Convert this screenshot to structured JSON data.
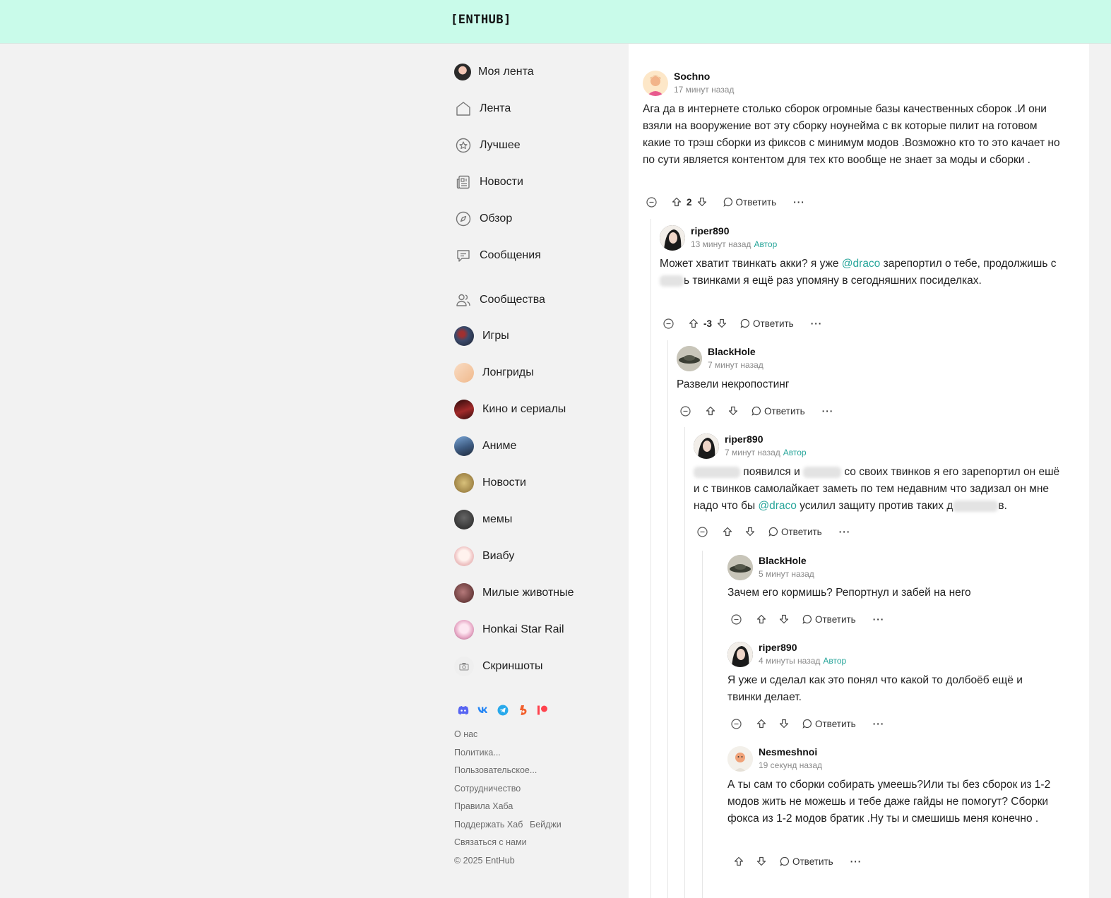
{
  "header": {
    "logo": "[ENTHUB]"
  },
  "sidebar": {
    "main_nav": [
      {
        "label": "Моя лента",
        "icon": "user-avatar"
      },
      {
        "label": "Лента",
        "icon": "home-icon"
      },
      {
        "label": "Лучшее",
        "icon": "star-icon"
      },
      {
        "label": "Новости",
        "icon": "newspaper-icon"
      },
      {
        "label": "Обзор",
        "icon": "compass-icon"
      },
      {
        "label": "Сообщения",
        "icon": "chat-icon"
      }
    ],
    "communities_label": "Сообщества",
    "communities": [
      {
        "label": "Игры",
        "color": "#3b4a6b"
      },
      {
        "label": "Лонгриды",
        "color": "#f4c9a6"
      },
      {
        "label": "Кино и сериалы",
        "color": "#7a1f1f"
      },
      {
        "label": "Аниме",
        "color": "#3d5a80"
      },
      {
        "label": "Новости",
        "color": "#b89a5a"
      },
      {
        "label": "мемы",
        "color": "#3a3a3a"
      },
      {
        "label": "Виабу",
        "color": "#f2d6d6"
      },
      {
        "label": "Милые животные",
        "color": "#6b3a3a"
      },
      {
        "label": "Honkai Star Rail",
        "color": "#e7c3d6"
      },
      {
        "label": "Скриншоты",
        "color": "#e9e9e9"
      }
    ],
    "socials": [
      {
        "icon": "discord-icon",
        "color": "#5865f2"
      },
      {
        "icon": "vk-icon",
        "color": "#2787f5"
      },
      {
        "icon": "telegram-icon",
        "color": "#29a9eb"
      },
      {
        "icon": "boosty-icon",
        "color": "#f15f2c"
      },
      {
        "icon": "patreon-icon",
        "color": "#ff424d"
      }
    ],
    "footer": {
      "about": "О нас",
      "policy": "Политика...",
      "terms": "Пользовательское...",
      "cooperation": "Сотрудничество",
      "rules": "Правила Хаба",
      "support": "Поддержать Хаб",
      "badges": "Бейджи",
      "contact": "Связаться с нами",
      "copyright": "© 2025 EntHub"
    }
  },
  "comments": [
    {
      "author": "Sochno",
      "time": "17 минут назад",
      "badge": "",
      "text": "Ага да в интернете столько сборок огромные базы качественных сборок .И они взяли на вооружение вот эту сборку ноунейма с вк которые пилит на готовом какие то трэш сборки из фиксов с минимум модов .Возможно кто то это качает но по сути является контентом для тех кто вообще не знает за моды и сборки .",
      "score": "2",
      "reply": "Ответить"
    },
    {
      "author": "riper890",
      "time": "13 минут назад",
      "badge": "Автор",
      "text_a": "Может хватит твинкать акки? я уже ",
      "mention": "@draco",
      "text_b": " зарепортил о тебе, продолжишь с",
      "text_c": "ь твинками я ещё раз упомяну в сегодняшних посиделках.",
      "score": "-3",
      "reply": "Ответить"
    },
    {
      "author": "BlackHole",
      "time": "7 минут назад",
      "badge": "",
      "text": "Развели некропостинг",
      "score": "",
      "reply": "Ответить"
    },
    {
      "author": "riper890",
      "time": "7 минут назад",
      "badge": "Автор",
      "text_a": " появился и ",
      "text_b": " со своих твинков я его зарепортил он ешё и с твинков самолайкает заметь по тем недавним что задизал он мне надо что бы ",
      "mention": "@draco",
      "text_c": " усилил защиту против таких д",
      "text_d": "в.",
      "score": "",
      "reply": "Ответить"
    },
    {
      "author": "BlackHole",
      "time": "5 минут назад",
      "badge": "",
      "text": "Зачем его кормишь? Репортнул и забей на него",
      "score": "",
      "reply": "Ответить"
    },
    {
      "author": "riper890",
      "time": "4 минуты назад",
      "badge": "Автор",
      "text": "Я уже и сделал как это понял что какой то долбоёб ещё и твинки делает.",
      "score": "",
      "reply": "Ответить"
    },
    {
      "author": "Nesmeshnoi",
      "time": "19 секунд назад",
      "badge": "",
      "text": "А ты сам то сборки собирать умеешь?Или ты без сборок из 1-2 модов жить не можешь и тебе даже гайды не помогут? Сборки фокса из 1-2 модов братик .Ну ты и смешишь меня конечно .",
      "score": "",
      "reply": "Ответить"
    }
  ]
}
